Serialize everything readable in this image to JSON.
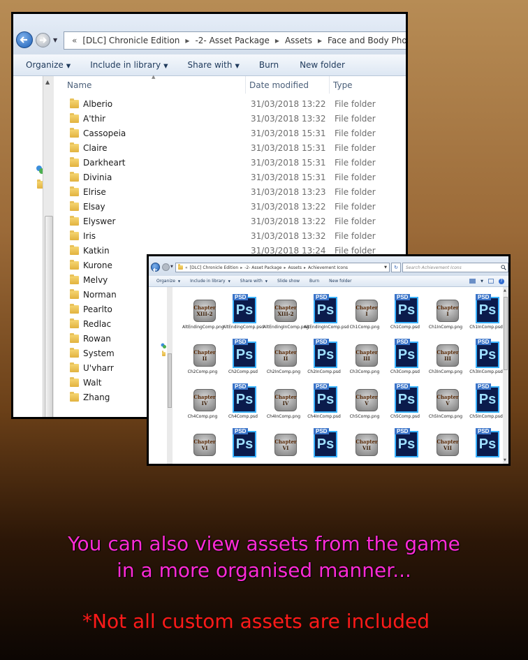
{
  "explorer_main": {
    "breadcrumb": [
      "«",
      "[DLC] Chronicle Edition",
      "▸",
      "-2- Asset Package",
      "▸",
      "Assets",
      "▸",
      "Face and Body Photos",
      "▸"
    ],
    "toolbar": [
      "Organize",
      "Include in library",
      "Share with",
      "Burn",
      "New folder"
    ],
    "columns": {
      "name": "Name",
      "date": "Date modified",
      "type": "Type"
    },
    "rows": [
      {
        "name": "Alberio",
        "date": "31/03/2018 13:22",
        "type": "File folder"
      },
      {
        "name": "A'thir",
        "date": "31/03/2018 13:32",
        "type": "File folder"
      },
      {
        "name": "Cassopeia",
        "date": "31/03/2018 15:31",
        "type": "File folder"
      },
      {
        "name": "Claire",
        "date": "31/03/2018 15:31",
        "type": "File folder"
      },
      {
        "name": "Darkheart",
        "date": "31/03/2018 15:31",
        "type": "File folder"
      },
      {
        "name": "Divinia",
        "date": "31/03/2018 15:31",
        "type": "File folder"
      },
      {
        "name": "Elrise",
        "date": "31/03/2018 13:23",
        "type": "File folder"
      },
      {
        "name": "Elsay",
        "date": "31/03/2018 13:22",
        "type": "File folder"
      },
      {
        "name": "Elyswer",
        "date": "31/03/2018 13:22",
        "type": "File folder"
      },
      {
        "name": "Iris",
        "date": "31/03/2018 13:32",
        "type": "File folder"
      },
      {
        "name": "Katkin",
        "date": "31/03/2018 13:24",
        "type": "File folder"
      },
      {
        "name": "Kurone",
        "date": "",
        "type": ""
      },
      {
        "name": "Melvy",
        "date": "",
        "type": ""
      },
      {
        "name": "Norman",
        "date": "",
        "type": ""
      },
      {
        "name": "Pearlto",
        "date": "",
        "type": ""
      },
      {
        "name": "Redlac",
        "date": "",
        "type": ""
      },
      {
        "name": "Rowan",
        "date": "",
        "type": ""
      },
      {
        "name": "System",
        "date": "",
        "type": ""
      },
      {
        "name": "U'vharr",
        "date": "",
        "type": ""
      },
      {
        "name": "Walt",
        "date": "",
        "type": ""
      },
      {
        "name": "Zhang",
        "date": "",
        "type": ""
      }
    ]
  },
  "explorer_icons": {
    "breadcrumb": [
      "«",
      "[DLC] Chronicle Edition",
      "▸",
      "-2- Asset Package",
      "▸",
      "Assets",
      "▸",
      "Achievement Icons"
    ],
    "search_placeholder": "Search Achievement Icons",
    "toolbar": [
      "Organize",
      "Include in library",
      "Share with",
      "Slide show",
      "Burn",
      "New folder"
    ],
    "icon_rows": [
      [
        {
          "kind": "chapter",
          "chapter": "Chapter",
          "numeral": "XIII-2",
          "label": "AltEndingComp.png"
        },
        {
          "kind": "psd",
          "label": "AltEndingComp.psd"
        },
        {
          "kind": "chapter",
          "chapter": "Chapter",
          "numeral": "XIII-2",
          "label": "AltEndingInComp.png"
        },
        {
          "kind": "psd",
          "label": "AltEndingInComp.psd"
        },
        {
          "kind": "chapter",
          "chapter": "Chapter",
          "numeral": "I",
          "label": "Ch1Comp.png"
        },
        {
          "kind": "psd",
          "label": "Ch1Comp.psd"
        },
        {
          "kind": "chapter",
          "chapter": "Chapter",
          "numeral": "I",
          "label": "Ch1InComp.png"
        },
        {
          "kind": "psd",
          "label": "Ch1InComp.psd"
        }
      ],
      [
        {
          "kind": "chapter",
          "chapter": "Chapter",
          "numeral": "II",
          "label": "Ch2Comp.png"
        },
        {
          "kind": "psd",
          "label": "Ch2Comp.psd"
        },
        {
          "kind": "chapter",
          "chapter": "Chapter",
          "numeral": "II",
          "label": "Ch2InComp.png"
        },
        {
          "kind": "psd",
          "label": "Ch2InComp.psd"
        },
        {
          "kind": "chapter",
          "chapter": "Chapter",
          "numeral": "III",
          "label": "Ch3Comp.png"
        },
        {
          "kind": "psd",
          "label": "Ch3Comp.psd"
        },
        {
          "kind": "chapter",
          "chapter": "Chapter",
          "numeral": "III",
          "label": "Ch3InComp.png"
        },
        {
          "kind": "psd",
          "label": "Ch3InComp.psd"
        }
      ],
      [
        {
          "kind": "chapter",
          "chapter": "Chapter",
          "numeral": "IV",
          "label": "Ch4Comp.png"
        },
        {
          "kind": "psd",
          "label": "Ch4Comp.psd"
        },
        {
          "kind": "chapter",
          "chapter": "Chapter",
          "numeral": "IV",
          "label": "Ch4InComp.png"
        },
        {
          "kind": "psd",
          "label": "Ch4InComp.psd"
        },
        {
          "kind": "chapter",
          "chapter": "Chapter",
          "numeral": "V",
          "label": "Ch5Comp.png"
        },
        {
          "kind": "psd",
          "label": "Ch5Comp.psd"
        },
        {
          "kind": "chapter",
          "chapter": "Chapter",
          "numeral": "V",
          "label": "Ch5InComp.png"
        },
        {
          "kind": "psd",
          "label": "Ch5InComp.psd"
        }
      ],
      [
        {
          "kind": "chapter",
          "chapter": "Chapter",
          "numeral": "VI",
          "label": ""
        },
        {
          "kind": "psd",
          "label": ""
        },
        {
          "kind": "chapter",
          "chapter": "Chapter",
          "numeral": "VI",
          "label": ""
        },
        {
          "kind": "psd",
          "label": ""
        },
        {
          "kind": "chapter",
          "chapter": "Chapter",
          "numeral": "VII",
          "label": ""
        },
        {
          "kind": "psd",
          "label": ""
        },
        {
          "kind": "chapter",
          "chapter": "Chapter",
          "numeral": "VII",
          "label": ""
        },
        {
          "kind": "psd",
          "label": ""
        }
      ]
    ],
    "psd_tag": "PSD",
    "psd_glyph": "Ps"
  },
  "caption": {
    "line1": "You can also view assets from the game",
    "line2": "in a more organised manner...",
    "note": "*Not all custom assets are included",
    "color_main": "#ff2bd6",
    "color_note": "#ff1a1a"
  }
}
